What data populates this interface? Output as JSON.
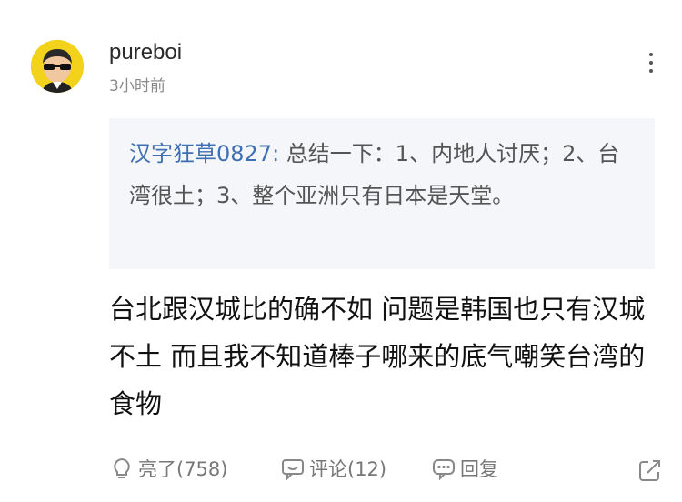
{
  "comment": {
    "username": "pureboi",
    "time": "3小时前",
    "quoted": {
      "user": "汉字狂草0827:",
      "text": " 总结一下：1、内地人讨厌；2、台湾很土；3、整个亚洲只有日本是天堂。"
    },
    "content": "台北跟汉城比的确不如 问题是韩国也只有汉城不土 而且我不知道棒子哪来的底气嘲笑台湾的食物"
  },
  "actions": {
    "like_label": "亮了(758)",
    "comment_label": "评论(12)",
    "reply_label": "回复"
  },
  "icons": {
    "more": "more-vertical-icon",
    "like": "lightbulb-icon",
    "comment": "comment-icon",
    "reply": "reply-icon",
    "share": "share-icon"
  },
  "colors": {
    "accent": "#3f6fb0",
    "quote_bg": "#f4f6f9",
    "meta": "#8a8a8a"
  }
}
